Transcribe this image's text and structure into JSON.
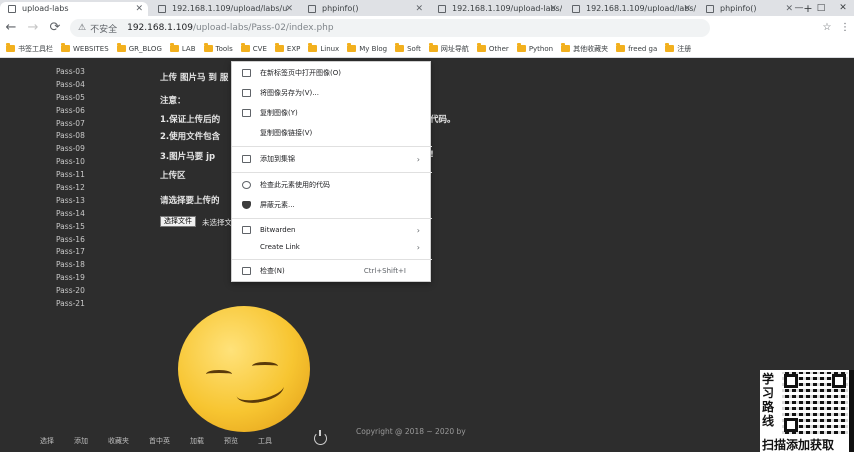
{
  "browser": {
    "tabs": [
      {
        "title": "upload-labs",
        "active": true
      },
      {
        "title": "192.168.1.109/upload/labs/u"
      },
      {
        "title": "phpinfo()"
      },
      {
        "title": "192.168.1.109/upload-labs/u"
      },
      {
        "title": "192.168.1.109/upload/labs/u"
      },
      {
        "title": "phpinfo()"
      }
    ],
    "new_tab": "+",
    "window_controls": {
      "minimize": "—",
      "maximize": "□",
      "close": "✕"
    },
    "toolbar": {
      "back": "←",
      "forward": "→",
      "reload": "⟳",
      "security_icon": "⚠",
      "security_label": "不安全",
      "url": "192.168.1.109",
      "url_path": "/upload-labs/Pass-02/index.php",
      "star": "☆",
      "menu": "⋮"
    },
    "bookmarks": [
      "书签工具栏",
      "WEBSITES",
      "GR_BLOG",
      "LAB",
      "Tools",
      "CVE",
      "EXP",
      "Linux",
      "My Blog",
      "Soft",
      "网址导航",
      "Other",
      "Python",
      "其他收藏夹",
      "freed ga",
      "注册"
    ]
  },
  "page": {
    "sidebar": [
      "Pass-03",
      "Pass-04",
      "Pass-05",
      "Pass-06",
      "Pass-07",
      "Pass-08",
      "Pass-09",
      "Pass-10",
      "Pass-11",
      "Pass-12",
      "Pass-13",
      "Pass-14",
      "Pass-15",
      "Pass-16",
      "Pass-17",
      "Pass-18",
      "Pass-19",
      "Pass-20",
      "Pass-21"
    ],
    "task_line": "上传 图片马 到 服",
    "note_heading": "注意：",
    "note_1": "1.保证上传后的",
    "note_1_tail": "代码。",
    "note_2": "2.使用文件包含",
    "note_3": "3.图片马要 jp",
    "note_3_tail": "!",
    "section_title": "上传区",
    "upload_prompt": "请选择要上传的",
    "file_button": "选择文件",
    "no_file": "未选择文件",
    "copyright": "Copyright @ 2018 ~ 2020 by"
  },
  "bottom_bar": [
    "选择",
    "添加",
    "收藏夹",
    "首中英",
    "加载",
    "预览",
    "工具"
  ],
  "context_menu": [
    {
      "label": "在新标签页中打开图像(O)",
      "icon": "open-image-icon"
    },
    {
      "label": "将图像另存为(V)...",
      "icon": "save-image-icon"
    },
    {
      "label": "复制图像(Y)",
      "icon": "copy-image-icon"
    },
    {
      "label": "复制图像链接(V)",
      "icon": ""
    },
    {
      "label": "添加到集锦",
      "icon": "collections-icon",
      "submenu": true
    },
    {
      "label": "检查此元素使用的代码",
      "icon": "inspect-code-icon"
    },
    {
      "label": "屏蔽元素...",
      "icon": "block-element-icon"
    },
    {
      "label": "Bitwarden",
      "icon": "bitwarden-icon",
      "submenu": true
    },
    {
      "label": "Create Link",
      "icon": "",
      "submenu": true
    },
    {
      "label": "检查(N)",
      "icon": "inspect-icon",
      "shortcut": "Ctrl+Shift+I"
    }
  ],
  "promo": {
    "vertical_text": "学习路线",
    "cta": "扫描添加获取"
  },
  "colors": {
    "page_bg": "#2d2d2d",
    "chrome_bg": "#dfe1e5",
    "folder": "#f2b01e",
    "smiley": "#f7c531"
  }
}
